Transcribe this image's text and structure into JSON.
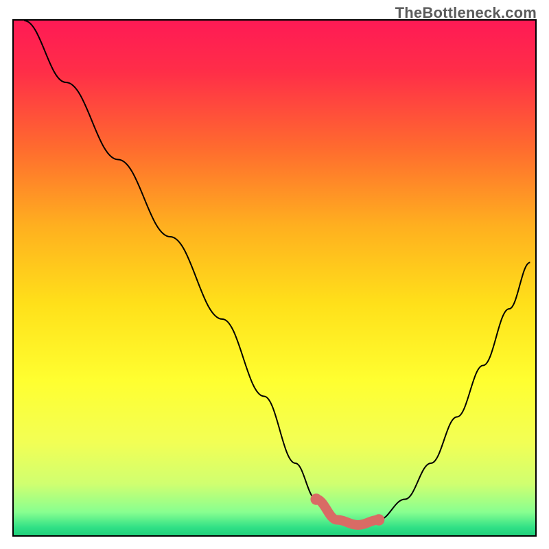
{
  "watermark": "TheBottleneck.com",
  "gradient_stops": [
    {
      "offset": 0.0,
      "color": "#ff1a55"
    },
    {
      "offset": 0.1,
      "color": "#ff2e48"
    },
    {
      "offset": 0.25,
      "color": "#ff6c2e"
    },
    {
      "offset": 0.4,
      "color": "#ffb01f"
    },
    {
      "offset": 0.55,
      "color": "#ffe01a"
    },
    {
      "offset": 0.7,
      "color": "#ffff30"
    },
    {
      "offset": 0.82,
      "color": "#f2ff55"
    },
    {
      "offset": 0.9,
      "color": "#d0ff70"
    },
    {
      "offset": 0.955,
      "color": "#88ff90"
    },
    {
      "offset": 0.985,
      "color": "#30e086"
    },
    {
      "offset": 1.0,
      "color": "#20d07a"
    }
  ],
  "chart_data": {
    "type": "line",
    "title": "",
    "xlabel": "",
    "ylabel": "",
    "xlim": [
      0,
      100
    ],
    "ylim": [
      0,
      100
    ],
    "series": [
      {
        "name": "curve",
        "x": [
          2,
          10,
          20,
          30,
          40,
          48,
          54,
          58,
          62,
          66,
          70,
          75,
          80,
          85,
          90,
          95,
          99
        ],
        "y": [
          100,
          88,
          73,
          58,
          42,
          27,
          14,
          7,
          3,
          2,
          3,
          7,
          14,
          23,
          33,
          44,
          53
        ]
      }
    ],
    "highlight": {
      "name": "optimal-zone",
      "x": [
        58,
        62,
        66,
        70
      ],
      "y": [
        7,
        3,
        2,
        3
      ],
      "color": "#d96b65"
    }
  }
}
